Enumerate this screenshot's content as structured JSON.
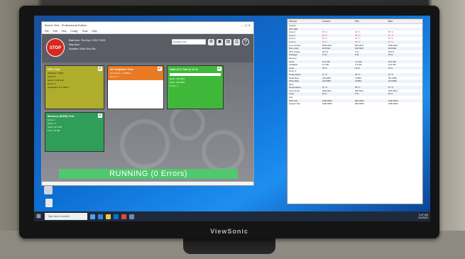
{
  "monitor": {
    "brand": "ViewSonic"
  },
  "burnin": {
    "window_title": "BurnIn Test - Professional Edition",
    "menu": [
      "File",
      "Edit",
      "Test",
      "Config",
      "Tools",
      "Help"
    ],
    "stop_label": "STOP",
    "header_lines": [
      "Start time: Thu Sep 1 09:17 2022",
      "Stop time:",
      "Duration: 000h 00m 00s"
    ],
    "search_placeholder": "Hardware info",
    "help_label": "?",
    "panels": {
      "cpu": {
        "title": "CPU Test",
        "lines": [
          "Utilization: 100%",
          "Cores: 8",
          "Speed: 3.60 GHz",
          "Errors: 0",
          "Operations: 2.1 Trillion"
        ]
      },
      "graphics": {
        "title": "2D Graphics Test",
        "lines": [
          "Operations: 1.2 Billion",
          "Errors: 0"
        ]
      },
      "disk": {
        "title": "Disk (C:) Test (1 of 1)",
        "lines": [
          "Read: 145 MB/s",
          "Write: 132 MB/s",
          "Errors: 0"
        ]
      },
      "memory": {
        "title": "Memory (RAM) Test",
        "lines": [
          "Cycle: 2",
          "Errors: 0",
          "Used: 12.4 GB",
          "Free: 3.5 GB"
        ]
      }
    },
    "status": "RUNNING (0 Errors)"
  },
  "hwinfo": {
    "columns": [
      "Sensor",
      "Current",
      "Min",
      "Max"
    ],
    "rows": [
      {
        "cells": [
          "System",
          "",
          "",
          ""
        ]
      },
      {
        "cells": [
          "CPU [#0]",
          "",
          "",
          ""
        ]
      },
      {
        "cells": [
          "Core 0",
          "85 °C",
          "42 °C",
          "88 °C"
        ],
        "red": true
      },
      {
        "cells": [
          "Core 1",
          "84 °C",
          "41 °C",
          "87 °C"
        ],
        "red": true
      },
      {
        "cells": [
          "Core 2",
          "86 °C",
          "42 °C",
          "89 °C"
        ],
        "red": true
      },
      {
        "cells": [
          "Core 3",
          "83 °C",
          "40 °C",
          "86 °C"
        ],
        "red": true
      },
      {
        "cells": [
          "Core Clocks",
          "3600 MHz",
          "800 MHz",
          "4200 MHz"
        ]
      },
      {
        "cells": [
          "Bus Clock",
          "100 MHz",
          "100 MHz",
          "100 MHz"
        ]
      },
      {
        "cells": [
          "CPU Usage",
          "100 %",
          "2 %",
          "100 %"
        ]
      },
      {
        "cells": [
          "Package",
          "72 W",
          "8 W",
          "75 W"
        ]
      },
      {
        "cells": [
          "Memory",
          "",
          "",
          ""
        ]
      },
      {
        "cells": [
          "Used",
          "12.4 GB",
          "3.1 GB",
          "12.6 GB"
        ]
      },
      {
        "cells": [
          "Available",
          "3.5 GB",
          "3.3 GB",
          "12.8 GB"
        ]
      },
      {
        "cells": [
          "Load",
          "78 %",
          "19 %",
          "79 %"
        ]
      },
      {
        "cells": [
          "Drive C:",
          "",
          "",
          ""
        ]
      },
      {
        "cells": [
          "Temperature",
          "41 °C",
          "33 °C",
          "42 °C"
        ]
      },
      {
        "cells": [
          "Read Rate",
          "145 MB/s",
          "0 MB/s",
          "151 MB/s"
        ]
      },
      {
        "cells": [
          "Write Rate",
          "132 MB/s",
          "0 MB/s",
          "140 MB/s"
        ]
      },
      {
        "cells": [
          "GPU",
          "",
          "",
          ""
        ]
      },
      {
        "cells": [
          "Temperature",
          "61 °C",
          "38 °C",
          "63 °C"
        ]
      },
      {
        "cells": [
          "Core Clock",
          "1100 MHz",
          "300 MHz",
          "1150 MHz"
        ]
      },
      {
        "cells": [
          "Load",
          "96 %",
          "0 %",
          "99 %"
        ]
      },
      {
        "cells": [
          "Fan",
          "",
          "",
          ""
        ]
      },
      {
        "cells": [
          "CPU Fan",
          "2450 RPM",
          "850 RPM",
          "2500 RPM"
        ]
      },
      {
        "cells": [
          "System Fan",
          "1320 RPM",
          "600 RPM",
          "1350 RPM"
        ]
      }
    ]
  },
  "taskbar": {
    "search_placeholder": "Type here to search",
    "time": "9:47 AM",
    "date": "9/1/2022"
  }
}
